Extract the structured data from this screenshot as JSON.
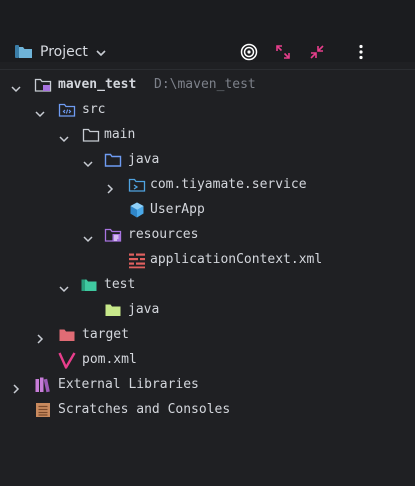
{
  "header": {
    "title": "Project",
    "icons": [
      "project-folder-icon",
      "chevron-down-icon",
      "locate-target-icon",
      "expand-all-icon",
      "collapse-all-icon",
      "more-options-icon"
    ]
  },
  "tree": {
    "root": {
      "label": "maven_test",
      "path": "D:\\maven_test"
    },
    "src": "src",
    "main": "main",
    "java_main": "java",
    "package": "com.tiyamate.service",
    "class": "UserApp",
    "resources": "resources",
    "app_context": "applicationContext.xml",
    "test": "test",
    "java_test": "java",
    "target": "target",
    "pom": "pom.xml",
    "ext_libs": "External Libraries",
    "scratches": "Scratches and Consoles"
  },
  "colors": {
    "background": "#1f2023",
    "text": "#d3d6dc",
    "muted": "#7d818a",
    "folder_blue": "#6f9cf3",
    "folder_green": "#3fc9a0",
    "folder_red": "#e06c75",
    "accent_pink": "#e83e8c",
    "purple": "#a874e0"
  }
}
